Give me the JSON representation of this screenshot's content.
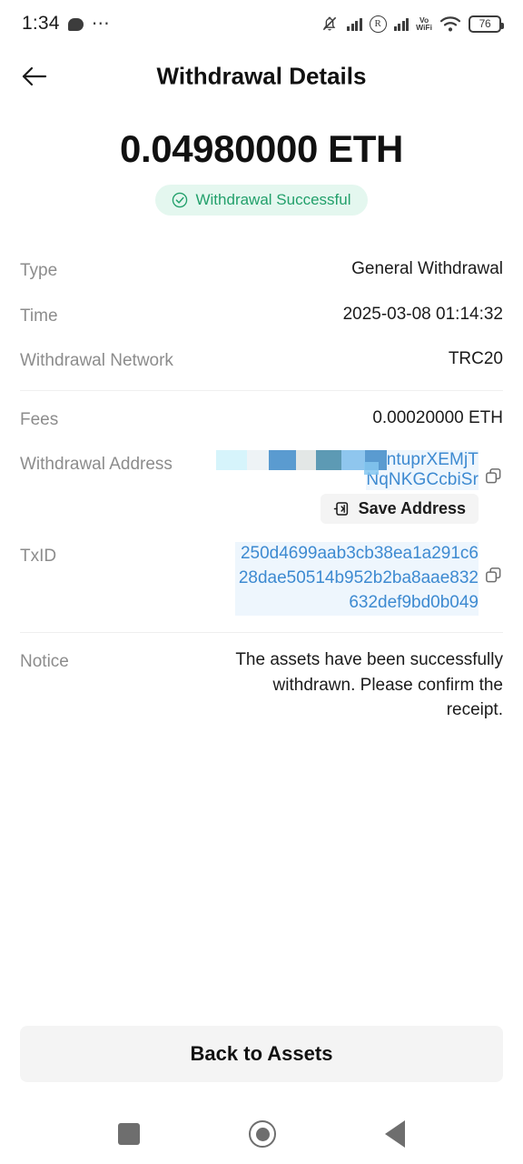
{
  "status_bar": {
    "time": "1:34",
    "icons": [
      "chat-bubble-icon",
      "more-dots-icon",
      "mute-bell-icon",
      "signal-bars-icon",
      "roaming-icon",
      "signal-bars-icon-2",
      "volte-wifi-icon",
      "wifi-icon",
      "battery-icon"
    ],
    "volte_label_top": "Vo",
    "volte_label_bottom": "WiFi",
    "battery_level": "76"
  },
  "app_bar": {
    "back_icon": "arrow-left-icon",
    "title": "Withdrawal Details"
  },
  "summary": {
    "amount": "0.04980000 ETH",
    "status_badge": {
      "icon": "check-circle-icon",
      "label": "Withdrawal Successful",
      "text_color": "#22a06b",
      "background_color": "#e4f7ef"
    }
  },
  "details": {
    "type": {
      "label": "Type",
      "value": "General Withdrawal"
    },
    "time": {
      "label": "Time",
      "value": "2025-03-08 01:14:32"
    },
    "network": {
      "label": "Withdrawal Network",
      "value": "TRC20"
    },
    "fees": {
      "label": "Fees",
      "value": "0.00020000 ETH"
    },
    "address": {
      "label": "Withdrawal Address",
      "redacted": true,
      "visible_part_1": "ntuprXEMjT",
      "visible_part_2": "NqNKGCcbiSr",
      "copy_icon": "copy-icon",
      "save_button": {
        "icon": "save-address-icon",
        "label": "Save Address"
      },
      "link_color": "#3d8ad1"
    },
    "txid": {
      "label": "TxID",
      "value": "250d4699aab3cb38ea1a291c628dae50514b952b2ba8aae832632def9bd0b049",
      "copy_icon": "copy-icon",
      "link_color": "#3d8ad1"
    },
    "notice": {
      "label": "Notice",
      "value": "The assets have been successfully withdrawn. Please confirm the receipt."
    }
  },
  "footer": {
    "back_to_assets": "Back to Assets"
  },
  "nav_bar": {
    "recents": "recents-square-icon",
    "home": "home-circle-icon",
    "back": "back-triangle-icon"
  }
}
